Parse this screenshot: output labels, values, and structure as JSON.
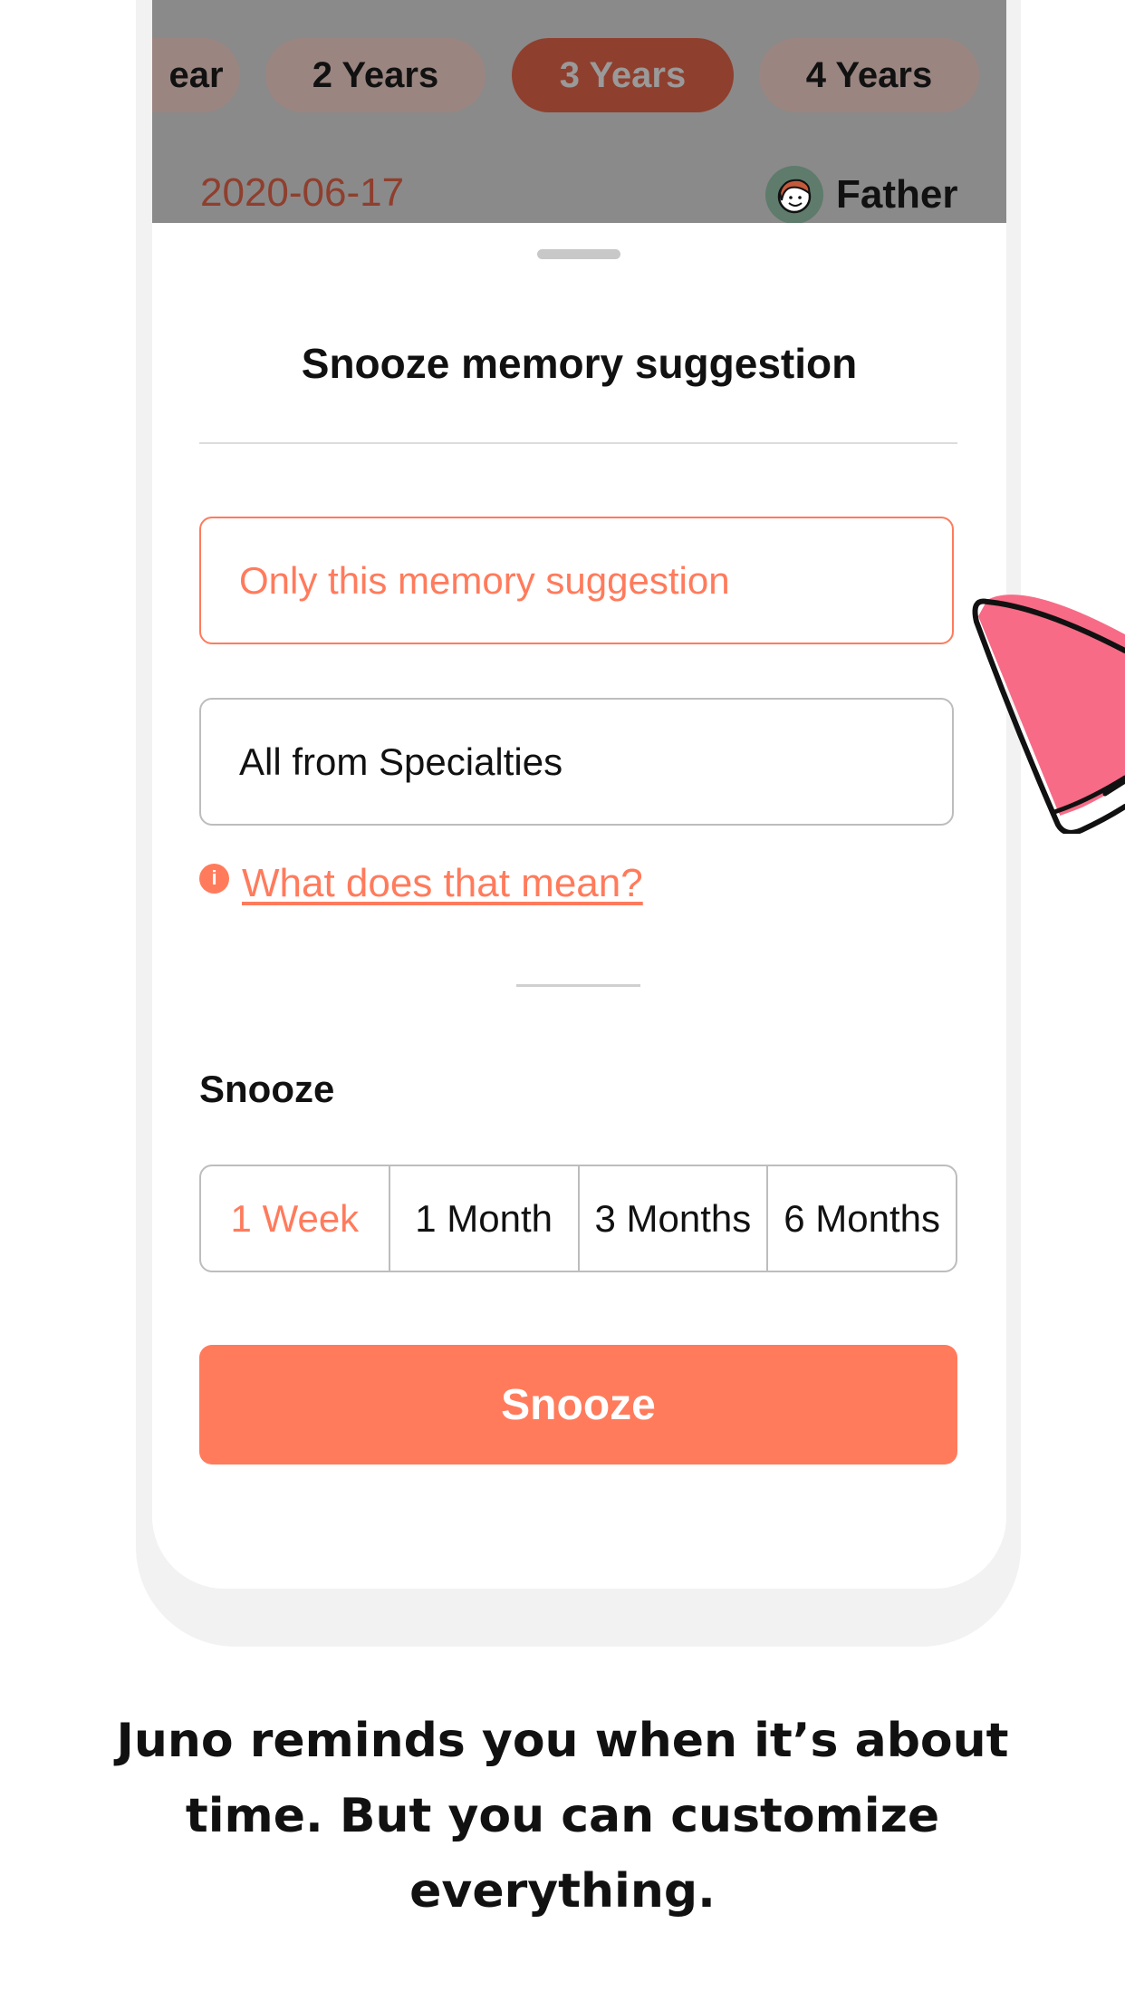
{
  "background_app": {
    "pills": [
      {
        "label": "ear",
        "active": false
      },
      {
        "label": "2 Years",
        "active": false
      },
      {
        "label": "3 Years",
        "active": true
      },
      {
        "label": "4 Years",
        "active": false
      }
    ],
    "date": "2020-06-17",
    "relation": "Father",
    "avatar_icon": "boy-face-icon"
  },
  "sheet": {
    "title": "Snooze memory suggestion",
    "options": [
      {
        "label": "Only this memory suggestion",
        "selected": true
      },
      {
        "label": "All from Specialties",
        "selected": false
      }
    ],
    "info_link": "What does that mean?",
    "snooze_label": "Snooze",
    "durations": [
      {
        "label": "1 Week",
        "selected": true
      },
      {
        "label": "1 Month",
        "selected": false
      },
      {
        "label": "3 Months",
        "selected": false
      },
      {
        "label": "6 Months",
        "selected": false
      }
    ],
    "snooze_button": "Snooze"
  },
  "caption": {
    "line1": "Juno reminds you when it’s about",
    "line2": "time. But you can customize",
    "line3": "everything."
  },
  "colors": {
    "accent": "#ff7b5c",
    "overlay": "#8a8a8a",
    "hat_pink": "#f76b86"
  }
}
